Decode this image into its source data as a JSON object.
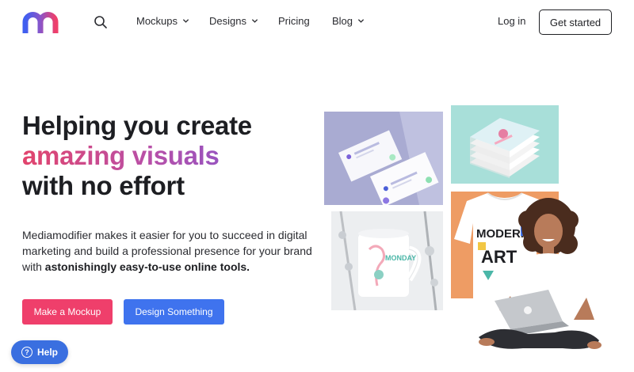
{
  "nav": {
    "items": [
      {
        "label": "Mockups",
        "dropdown": true
      },
      {
        "label": "Designs",
        "dropdown": true
      },
      {
        "label": "Pricing",
        "dropdown": false
      },
      {
        "label": "Blog",
        "dropdown": true
      }
    ],
    "login": "Log in",
    "get_started": "Get started"
  },
  "hero": {
    "line1": "Helping you create",
    "line2": "amazing visuals",
    "line3": "with no effort",
    "desc_text": "Mediamodifier makes it easier for you to succeed in digital marketing and build a professional presence for your brand with",
    "desc_bold": "astonishingly easy-to-use online tools."
  },
  "buttons": {
    "mockup": "Make a Mockup",
    "design": "Design Something"
  },
  "help": {
    "label": "Help",
    "icon_glyph": "?"
  },
  "images": {
    "shirt_text_top": "MODERN",
    "shirt_text_bottom": "ART",
    "mug_text": "MONDAY"
  },
  "colors": {
    "brand_pink": "#ef3f6b",
    "brand_blue": "#3f73ee",
    "help_blue": "#3a6fe0"
  },
  "icons": {
    "logo": "mediamodifier-logo",
    "search": "search-icon",
    "chevron": "chevron-down-icon"
  }
}
